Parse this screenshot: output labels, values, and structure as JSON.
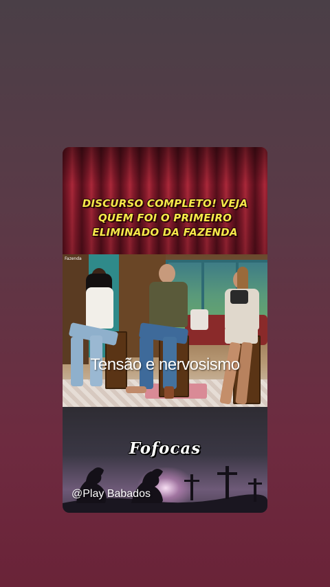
{
  "post": {
    "headline_lines": [
      "DISCURSO COMPLETO! VEJA",
      "QUEM FOI O PRIMEIRO",
      "ELIMINADO DA FAZENDA"
    ],
    "tv_logo": "Fazenda",
    "caption": "Tensão e nervosismo",
    "brand_title": "Fofocas",
    "handle": "@Play Babados"
  },
  "colors": {
    "headline": "#f5e94a",
    "curtain": "#8e1c2e",
    "background_top": "#4a3f47",
    "background_bottom": "#6a2338"
  },
  "icons": {
    "praying_silhouettes": "praying-silhouette-icon",
    "crosses": "cross-icon"
  }
}
